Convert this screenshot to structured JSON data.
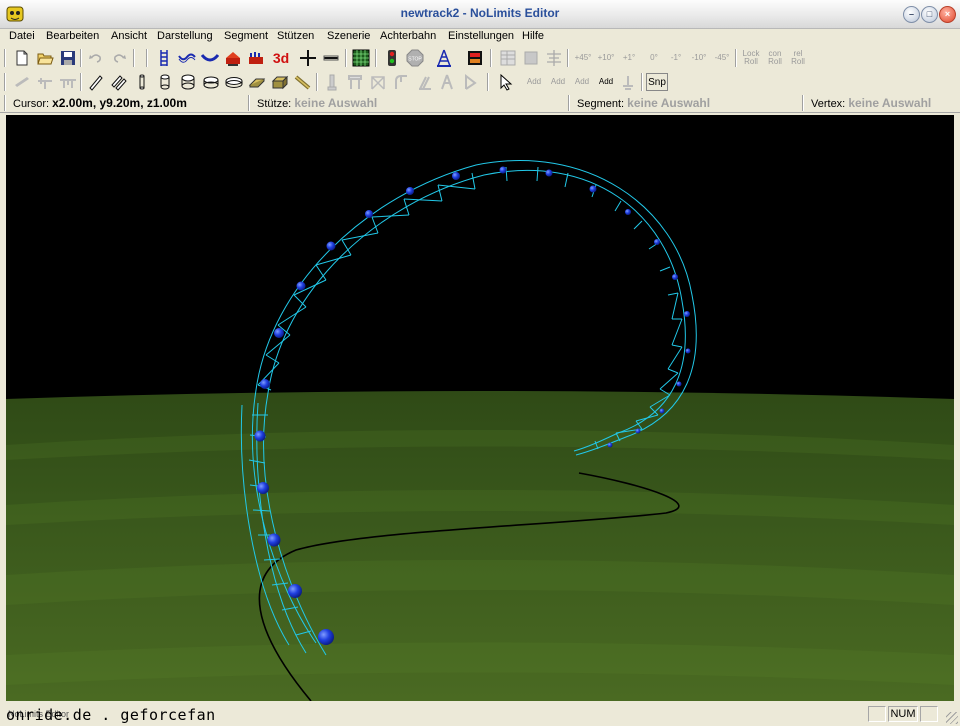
{
  "window": {
    "title": "newtrack2 - NoLimits Editor",
    "buttons": {
      "minimize": "–",
      "maximize": "□",
      "close": "×"
    }
  },
  "menu": [
    "Datei",
    "Bearbeiten",
    "Ansicht",
    "Darstellung",
    "Segment",
    "Stützen",
    "Szenerie",
    "Achterbahn",
    "Einstellungen",
    "Hilfe"
  ],
  "toolbar1": {
    "text_buttons": {
      "view_3d": "3d",
      "angle_p45": "+45°",
      "angle_p10": "+10°",
      "angle_p1": "+1°",
      "angle_0": "0°",
      "angle_m1": "-1°",
      "angle_m10": "-10°",
      "angle_m45": "-45°",
      "lock_roll": "Lock Roll",
      "con_roll": "con Roll",
      "rel_roll": "rel Roll"
    }
  },
  "toolbar2": {
    "text_buttons": {
      "add1": "Add",
      "add2": "Add",
      "add3": "Add",
      "add4": "Add",
      "snap": "Snp"
    }
  },
  "info": {
    "cursor_label": "Cursor:",
    "cursor_value": "x2.00m, y9.20m, z1.00m",
    "support_label": "Stütze:",
    "support_value": "keine Auswahl",
    "segment_label": "Segment:",
    "segment_value": "keine Auswahl",
    "vertex_label": "Vertex:",
    "vertex_value": "keine Auswahl"
  },
  "viewport": {
    "sky_color": "#000000",
    "ground_color": "#2e4a14",
    "track_color": "#22c8e8",
    "node_color": "#1b3be0"
  },
  "status": {
    "left_text": "NoLimits Editor",
    "num": "NUM",
    "watermark": "onride.de . geforcefan"
  }
}
